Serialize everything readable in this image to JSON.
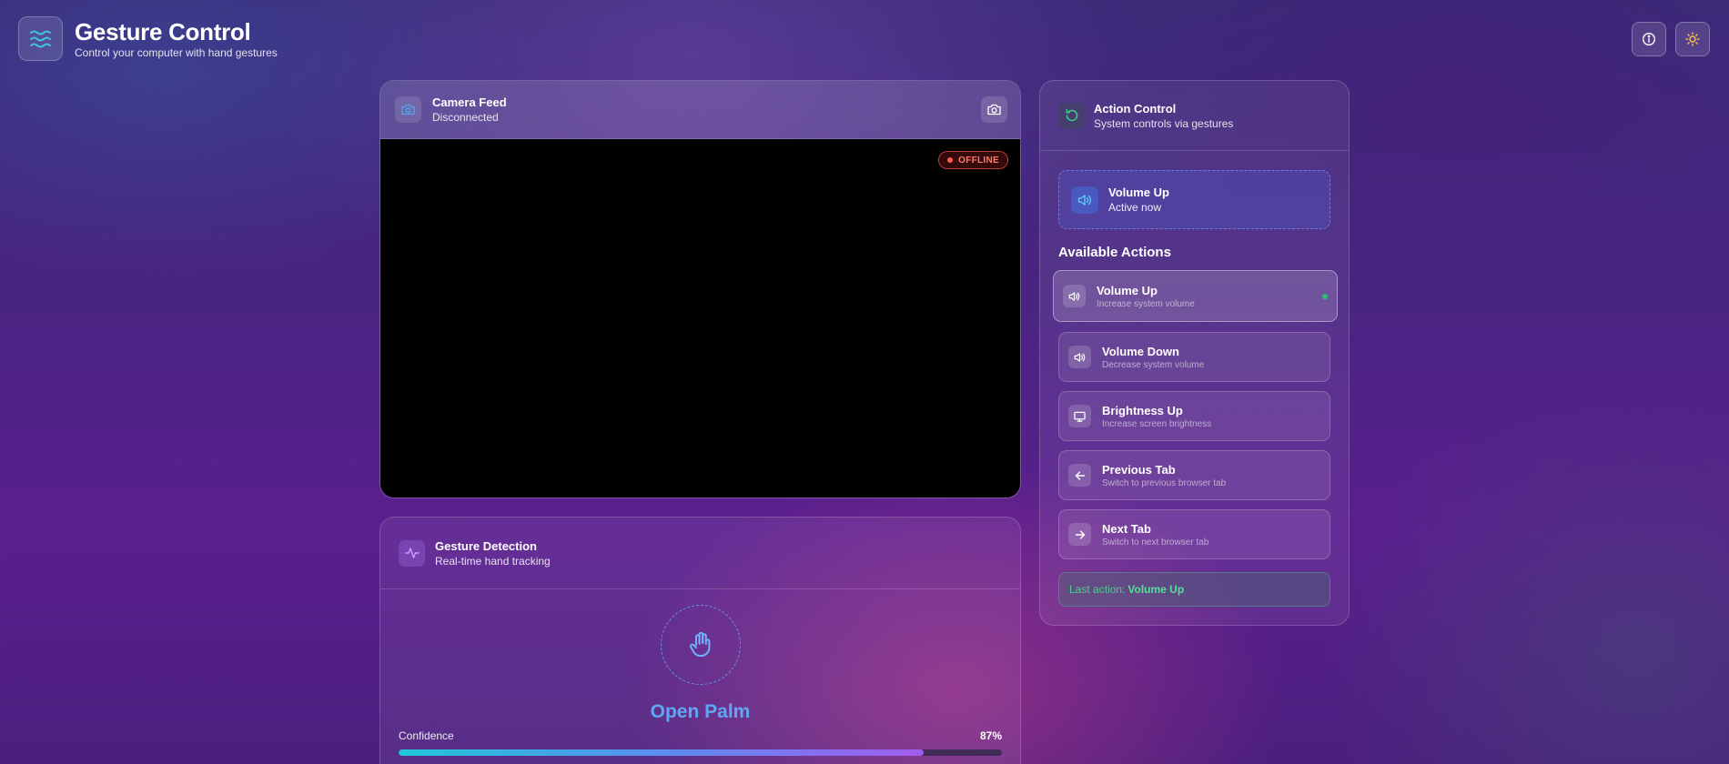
{
  "app": {
    "title": "Gesture Control",
    "subtitle": "Control your computer with hand gestures",
    "logo_icon": "waves-icon"
  },
  "header_actions": [
    {
      "name": "info-button",
      "icon": "info-icon"
    },
    {
      "name": "theme-toggle-button",
      "icon": "sun-icon"
    }
  ],
  "camera": {
    "title": "Camera Feed",
    "status": "Disconnected",
    "badge": "OFFLINE",
    "badge_color": "#ff5a4e"
  },
  "gesture": {
    "title": "Gesture Detection",
    "subtitle": "Real-time hand tracking",
    "detected": "Open Palm",
    "confidence_label": "Confidence",
    "confidence_text": "87%",
    "confidence": 0.87
  },
  "action_control": {
    "title": "Action Control",
    "subtitle": "System controls via gestures",
    "active": {
      "title": "Volume Up",
      "status": "Active now"
    },
    "available_title": "Available Actions",
    "actions": [
      {
        "title": "Volume Up",
        "desc": "Increase system volume",
        "icon": "volume-icon",
        "selected": true
      },
      {
        "title": "Volume Down",
        "desc": "Decrease system volume",
        "icon": "volume-icon",
        "selected": false
      },
      {
        "title": "Brightness Up",
        "desc": "Increase screen brightness",
        "icon": "monitor-icon",
        "selected": false
      },
      {
        "title": "Previous Tab",
        "desc": "Switch to previous browser tab",
        "icon": "arrow-left-icon",
        "selected": false
      },
      {
        "title": "Next Tab",
        "desc": "Switch to next browser tab",
        "icon": "arrow-right-icon",
        "selected": false
      }
    ],
    "last_action_label": "Last action:",
    "last_action_value": "Volume Up"
  },
  "colors": {
    "accent_blue": "#5fa6f5",
    "success_green": "#49d28a",
    "offline_red": "#ff5a4e"
  }
}
